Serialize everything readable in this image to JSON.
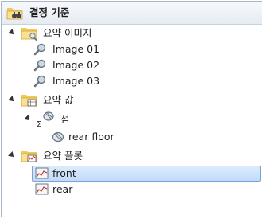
{
  "tree": {
    "root": {
      "label": "결정 기준",
      "icon": "folder-binoculars-icon"
    },
    "groups": [
      {
        "label": "요약 이미지",
        "icon": "folder-image-icon",
        "items": [
          {
            "label": "Image 01",
            "icon": "image-magnifier-icon"
          },
          {
            "label": "Image 02",
            "icon": "image-magnifier-icon"
          },
          {
            "label": "Image 03",
            "icon": "image-magnifier-icon"
          }
        ]
      },
      {
        "label": "요약 값",
        "icon": "folder-table-icon",
        "subgroup": {
          "label": "점",
          "icon": "sigma-point-icon"
        },
        "items": [
          {
            "label": "rear floor",
            "icon": "point-icon"
          }
        ]
      },
      {
        "label": "요약 플롯",
        "icon": "folder-plot-icon",
        "items": [
          {
            "label": "front",
            "icon": "plot-icon",
            "selected": true
          },
          {
            "label": "rear",
            "icon": "plot-icon"
          }
        ]
      }
    ]
  },
  "colors": {
    "selection": "#cce0fa",
    "selection_border": "#7da2ce",
    "folder": "#f3c85e",
    "plot_line": "#c0392b"
  }
}
